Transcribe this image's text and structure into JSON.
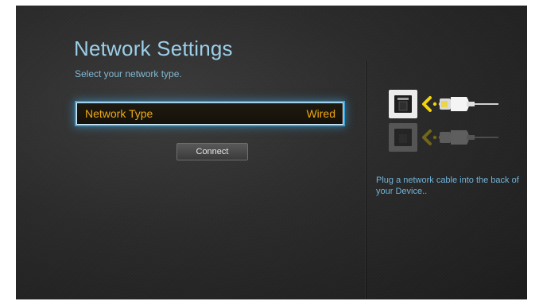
{
  "screen": {
    "title": "Network Settings",
    "subtitle": "Select your network type."
  },
  "network_type": {
    "label": "Network Type",
    "value": "Wired"
  },
  "connect_button": {
    "label": "Connect"
  },
  "help_panel": {
    "instruction": "Plug a network cable into the back of your Device..",
    "illustration_icons": [
      "ethernet-port-icon",
      "arrow-left-icon",
      "network-cable-icon"
    ]
  },
  "colors": {
    "title": "#9ccfe8",
    "selected_text": "#f1a912",
    "focus_glow": "#3aa6e0",
    "instruction_text": "#72b4d8",
    "arrow": "#f2d30c"
  }
}
